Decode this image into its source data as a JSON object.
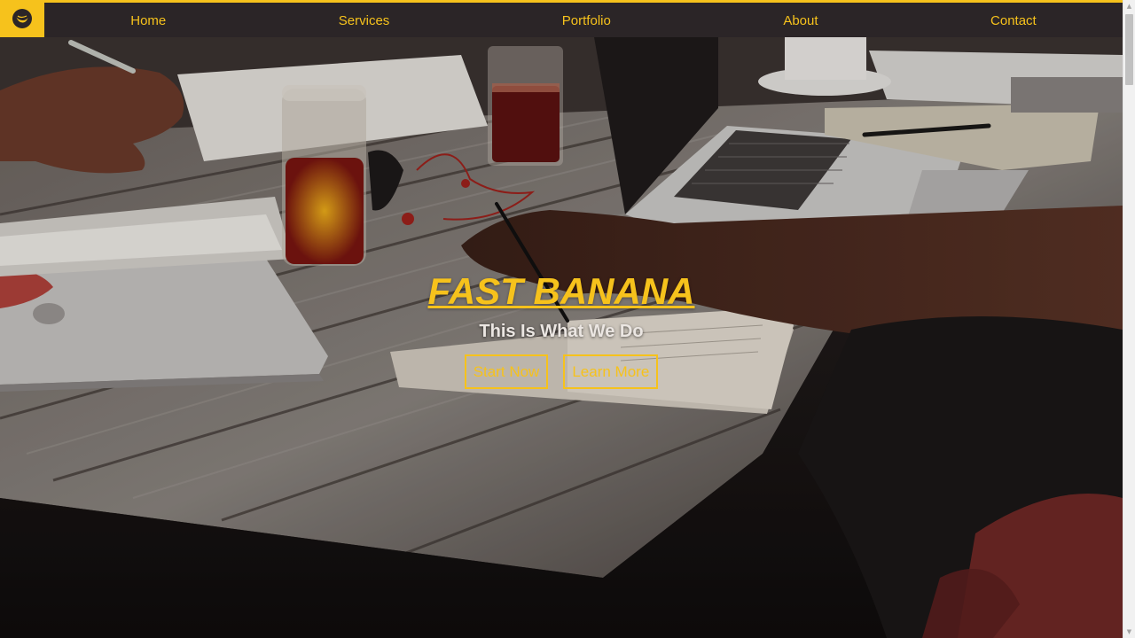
{
  "nav": {
    "logo_icon": "banana-logo-icon",
    "items": [
      {
        "label": "Home"
      },
      {
        "label": "Services"
      },
      {
        "label": "Portfolio"
      },
      {
        "label": "About"
      },
      {
        "label": "Contact"
      }
    ]
  },
  "hero": {
    "title": "FAST BANANA",
    "subtitle": "This Is What We Do",
    "buttons": [
      {
        "label": "Start Now"
      },
      {
        "label": "Learn More"
      }
    ],
    "background": "coworking-desk-photo"
  },
  "colors": {
    "accent": "#f6c21c",
    "nav_background": "#2b2527",
    "subtitle": "#ebe6e2"
  },
  "scrollbar": {
    "up_icon": "scroll-up-arrow-icon",
    "down_icon": "scroll-down-arrow-icon"
  }
}
